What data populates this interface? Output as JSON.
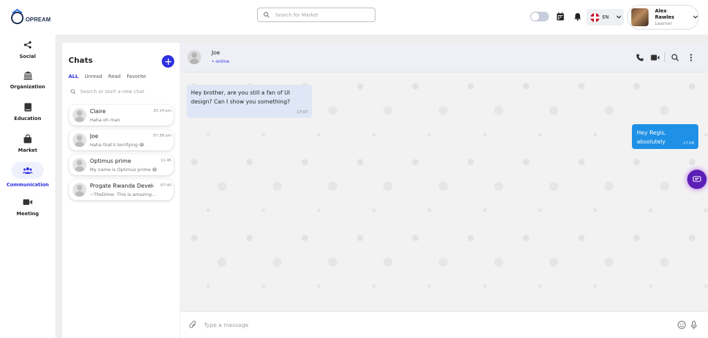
{
  "header": {
    "logo_text": "OPREAM",
    "search_placeholder": "Search for Market",
    "language_code": "EN",
    "user": {
      "name": "Alex Rawles",
      "role": "Learner"
    }
  },
  "nav": {
    "items": [
      {
        "label": "Social",
        "icon": "share-icon"
      },
      {
        "label": "Organization",
        "icon": "bank-icon"
      },
      {
        "label": "Education",
        "icon": "book-icon"
      },
      {
        "label": "Market",
        "icon": "shopping-bag-icon"
      },
      {
        "label": "Communication",
        "icon": "users-icon",
        "active": true
      },
      {
        "label": "Meeting",
        "icon": "video-camera-icon"
      }
    ]
  },
  "chats": {
    "title": "Chats",
    "filters": [
      "ALL",
      "Unread",
      "Read",
      "Favorite"
    ],
    "active_filter": "ALL",
    "search_placeholder": "Search or start a new chat",
    "list": [
      {
        "name": "Claire",
        "time": "10:14 pm",
        "preview": "Haha oh man"
      },
      {
        "name": "Joe",
        "time": "07:38 pm",
        "preview": "Haha that's terrifying 😂"
      },
      {
        "name": "Optimus prime",
        "time": "11:45",
        "preview": "My name is Optimus prime 😂"
      },
      {
        "name": "Progate Rwanda Develo...",
        "time": "07:40",
        "preview": "~TheDime: This is amazing..."
      }
    ]
  },
  "conversation": {
    "name": "Joe",
    "status": "• online",
    "messages": [
      {
        "direction": "in",
        "text": "Hey brother, are you still a fan of UI design? Can I show you something?",
        "time": "17:07"
      },
      {
        "direction": "out",
        "text": "Hey Regis, absolutely",
        "time": "17:08"
      }
    ],
    "composer_placeholder": "Type a message"
  },
  "colors": {
    "accent": "#2d2fe0",
    "outgoing_bubble": "#1e90e6",
    "incoming_bubble": "#dfe6f6",
    "fab": "#5b1fb6"
  }
}
